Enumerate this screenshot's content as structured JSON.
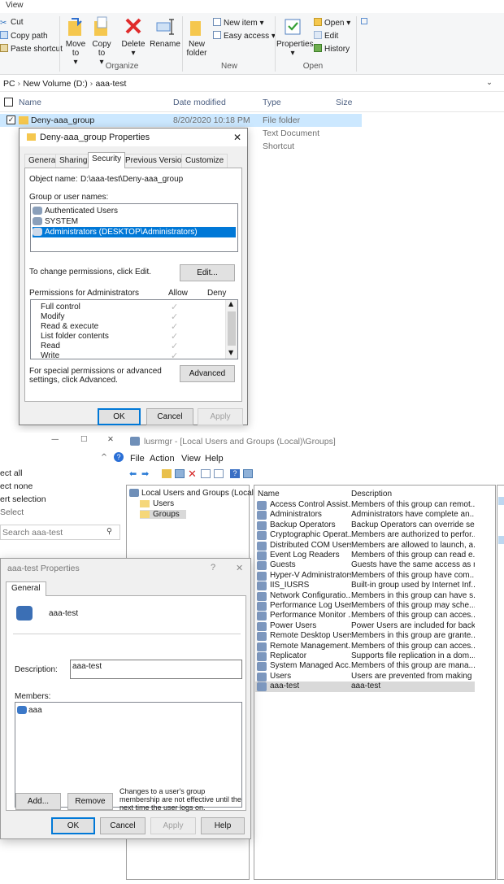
{
  "explorer": {
    "ribbon_tab": "View",
    "clipboard": {
      "cut": "Cut",
      "copy_path": "Copy path",
      "paste_shortcut": "Paste shortcut"
    },
    "organize": {
      "move_to": "Move to",
      "move_arrow": "▾",
      "copy_to": "Copy to",
      "copy_arrow": "▾",
      "delete": "Delete",
      "delete_arrow": "▾",
      "rename": "Rename",
      "label": "Organize"
    },
    "new": {
      "new_folder": "New folder",
      "new_item": "New item ▾",
      "easy_access": "Easy access ▾",
      "label": "New"
    },
    "open": {
      "properties": "Properties",
      "properties_arrow": "▾",
      "open": "Open ▾",
      "edit": "Edit",
      "history": "History",
      "label": "Open"
    },
    "address": {
      "pc": "PC",
      "volume": "New Volume (D:)",
      "folder": "aaa-test"
    },
    "columns": {
      "name": "Name",
      "date": "Date modified",
      "type": "Type",
      "size": "Size"
    },
    "files": [
      {
        "name": "Deny-aaa_group",
        "date": "8/20/2020 10:18 PM",
        "type": "File folder"
      },
      {
        "type": "Text Document"
      },
      {
        "type": "Shortcut"
      }
    ],
    "left_nav": {
      "select_all": "ect all",
      "select_none": "ect none",
      "invert": "ert selection",
      "select": "Select"
    },
    "search_placeholder": "Search aaa-test"
  },
  "props_dialog": {
    "title": "Deny-aaa_group Properties",
    "tabs": [
      "General",
      "Sharing",
      "Security",
      "Previous Versions",
      "Customize"
    ],
    "object_label": "Object name:",
    "object_value": "D:\\aaa-test\\Deny-aaa_group",
    "group_label": "Group or user names:",
    "users": [
      "Authenticated Users",
      "SYSTEM",
      "Administrators (DESKTOP\\Administrators)"
    ],
    "change_text": "To change permissions, click Edit.",
    "edit_button": "Edit...",
    "perm_header": "Permissions for Administrators",
    "allow": "Allow",
    "deny": "Deny",
    "permissions": [
      "Full control",
      "Modify",
      "Read & execute",
      "List folder contents",
      "Read",
      "Write"
    ],
    "check_glyph": "✓",
    "advanced_text": "For special permissions or advanced settings, click Advanced.",
    "advanced_button": "Advanced",
    "ok": "OK",
    "cancel": "Cancel",
    "apply": "Apply"
  },
  "lusrmgr": {
    "title": "lusrmgr - [Local Users and Groups (Local)\\Groups]",
    "menu": [
      "File",
      "Action",
      "View",
      "Help"
    ],
    "tree": {
      "root": "Local Users and Groups (Local)",
      "users": "Users",
      "groups": "Groups"
    },
    "columns": {
      "name": "Name",
      "description": "Description"
    },
    "groups": [
      {
        "name": "Access Control Assist...",
        "desc": "Members of this group can remot..."
      },
      {
        "name": "Administrators",
        "desc": "Administrators have complete an..."
      },
      {
        "name": "Backup Operators",
        "desc": "Backup Operators can override se..."
      },
      {
        "name": "Cryptographic Operat...",
        "desc": "Members are authorized to perfor..."
      },
      {
        "name": "Distributed COM Users",
        "desc": "Members are allowed to launch, a..."
      },
      {
        "name": "Event Log Readers",
        "desc": "Members of this group can read e..."
      },
      {
        "name": "Guests",
        "desc": "Guests have the same access as m..."
      },
      {
        "name": "Hyper-V Administrators",
        "desc": "Members of this group have com..."
      },
      {
        "name": "IIS_IUSRS",
        "desc": "Built-in group used by Internet Inf..."
      },
      {
        "name": "Network Configuratio...",
        "desc": "Members in this group can have s..."
      },
      {
        "name": "Performance Log Users",
        "desc": "Members of this group may sche..."
      },
      {
        "name": "Performance Monitor ...",
        "desc": "Members of this group can acces..."
      },
      {
        "name": "Power Users",
        "desc": "Power Users are included for back..."
      },
      {
        "name": "Remote Desktop Users",
        "desc": "Members in this group are grante..."
      },
      {
        "name": "Remote Management...",
        "desc": "Members of this group can acces..."
      },
      {
        "name": "Replicator",
        "desc": "Supports file replication in a dom..."
      },
      {
        "name": "System Managed Acc...",
        "desc": "Members of this group are mana..."
      },
      {
        "name": "Users",
        "desc": "Users are prevented from making ..."
      },
      {
        "name": "aaa-test",
        "desc": "aaa-test"
      }
    ]
  },
  "group_dialog": {
    "title": "aaa-test Properties",
    "help_glyph": "?",
    "close_glyph": "✕",
    "tab": "General",
    "group_name": "aaa-test",
    "description_label": "Description:",
    "description_value": "aaa-test",
    "members_label": "Members:",
    "members": [
      "aaa"
    ],
    "add": "Add...",
    "remove": "Remove",
    "note": "Changes to a user's group membership are not effective until the next time the user logs on.",
    "ok": "OK",
    "cancel": "Cancel",
    "apply": "Apply",
    "help": "Help"
  },
  "window_controls": {
    "min": "—",
    "max": "☐",
    "close": "✕"
  }
}
